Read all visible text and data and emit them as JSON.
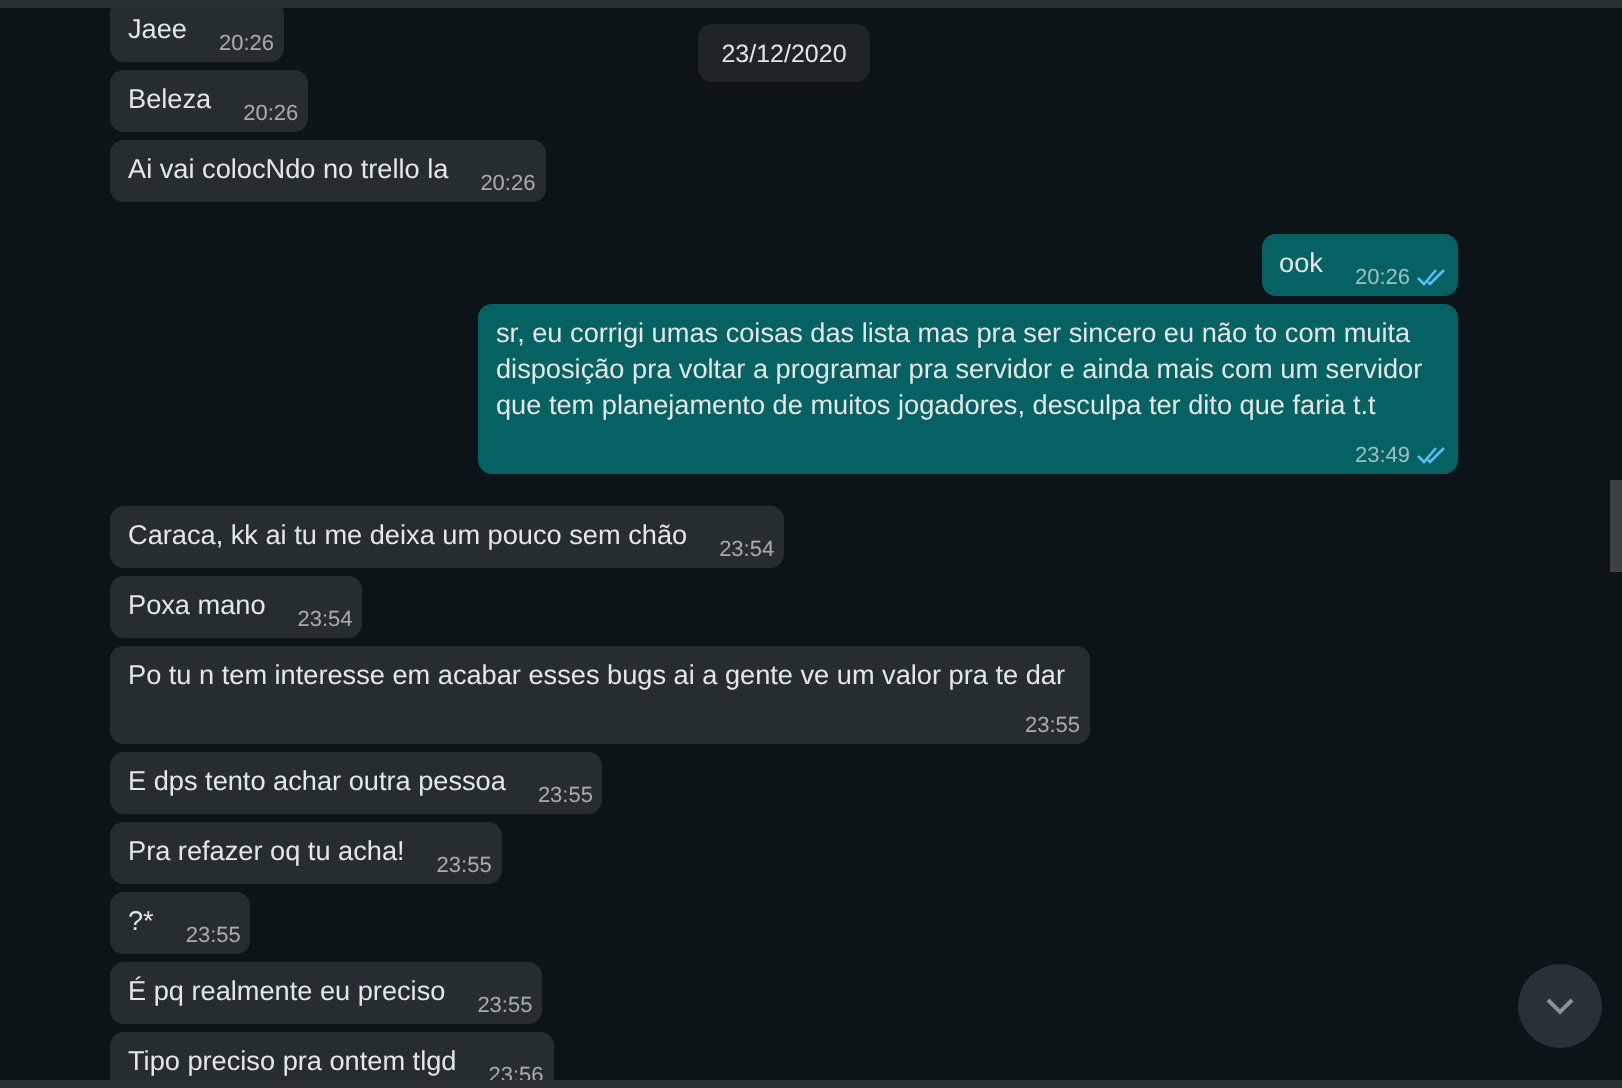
{
  "date_badge": "23/12/2020",
  "messages": [
    {
      "kind": "received",
      "text": "Jaee",
      "time": "20:26"
    },
    {
      "kind": "received",
      "text": "Beleza",
      "time": "20:26"
    },
    {
      "kind": "received",
      "text": "Ai vai colocNdo no trello la",
      "time": "20:26"
    },
    {
      "kind": "sent",
      "text": "ook",
      "time": "20:26",
      "read": true
    },
    {
      "kind": "sent",
      "text": "sr, eu corrigi umas coisas das lista mas pra ser sincero eu não to com muita disposição pra voltar a programar pra servidor e ainda mais com um servidor que tem planejamento de muitos jogadores, desculpa ter dito que faria t.t",
      "time": "23:49",
      "read": true
    },
    {
      "kind": "received",
      "text": "Caraca, kk ai tu me deixa um pouco sem chão",
      "time": "23:54"
    },
    {
      "kind": "received",
      "text": "Poxa mano",
      "time": "23:54"
    },
    {
      "kind": "received",
      "text": "Po tu n tem interesse em acabar esses bugs ai a gente ve um valor pra te dar",
      "time": "23:55"
    },
    {
      "kind": "received",
      "text": "E dps tento achar outra pessoa",
      "time": "23:55"
    },
    {
      "kind": "received",
      "text": "Pra refazer oq tu acha!",
      "time": "23:55"
    },
    {
      "kind": "received",
      "text": "?*",
      "time": "23:55"
    },
    {
      "kind": "received",
      "text": "É pq realmente eu preciso",
      "time": "23:55"
    },
    {
      "kind": "received",
      "text": "Tipo preciso pra ontem tlgd",
      "time": "23:56"
    }
  ]
}
